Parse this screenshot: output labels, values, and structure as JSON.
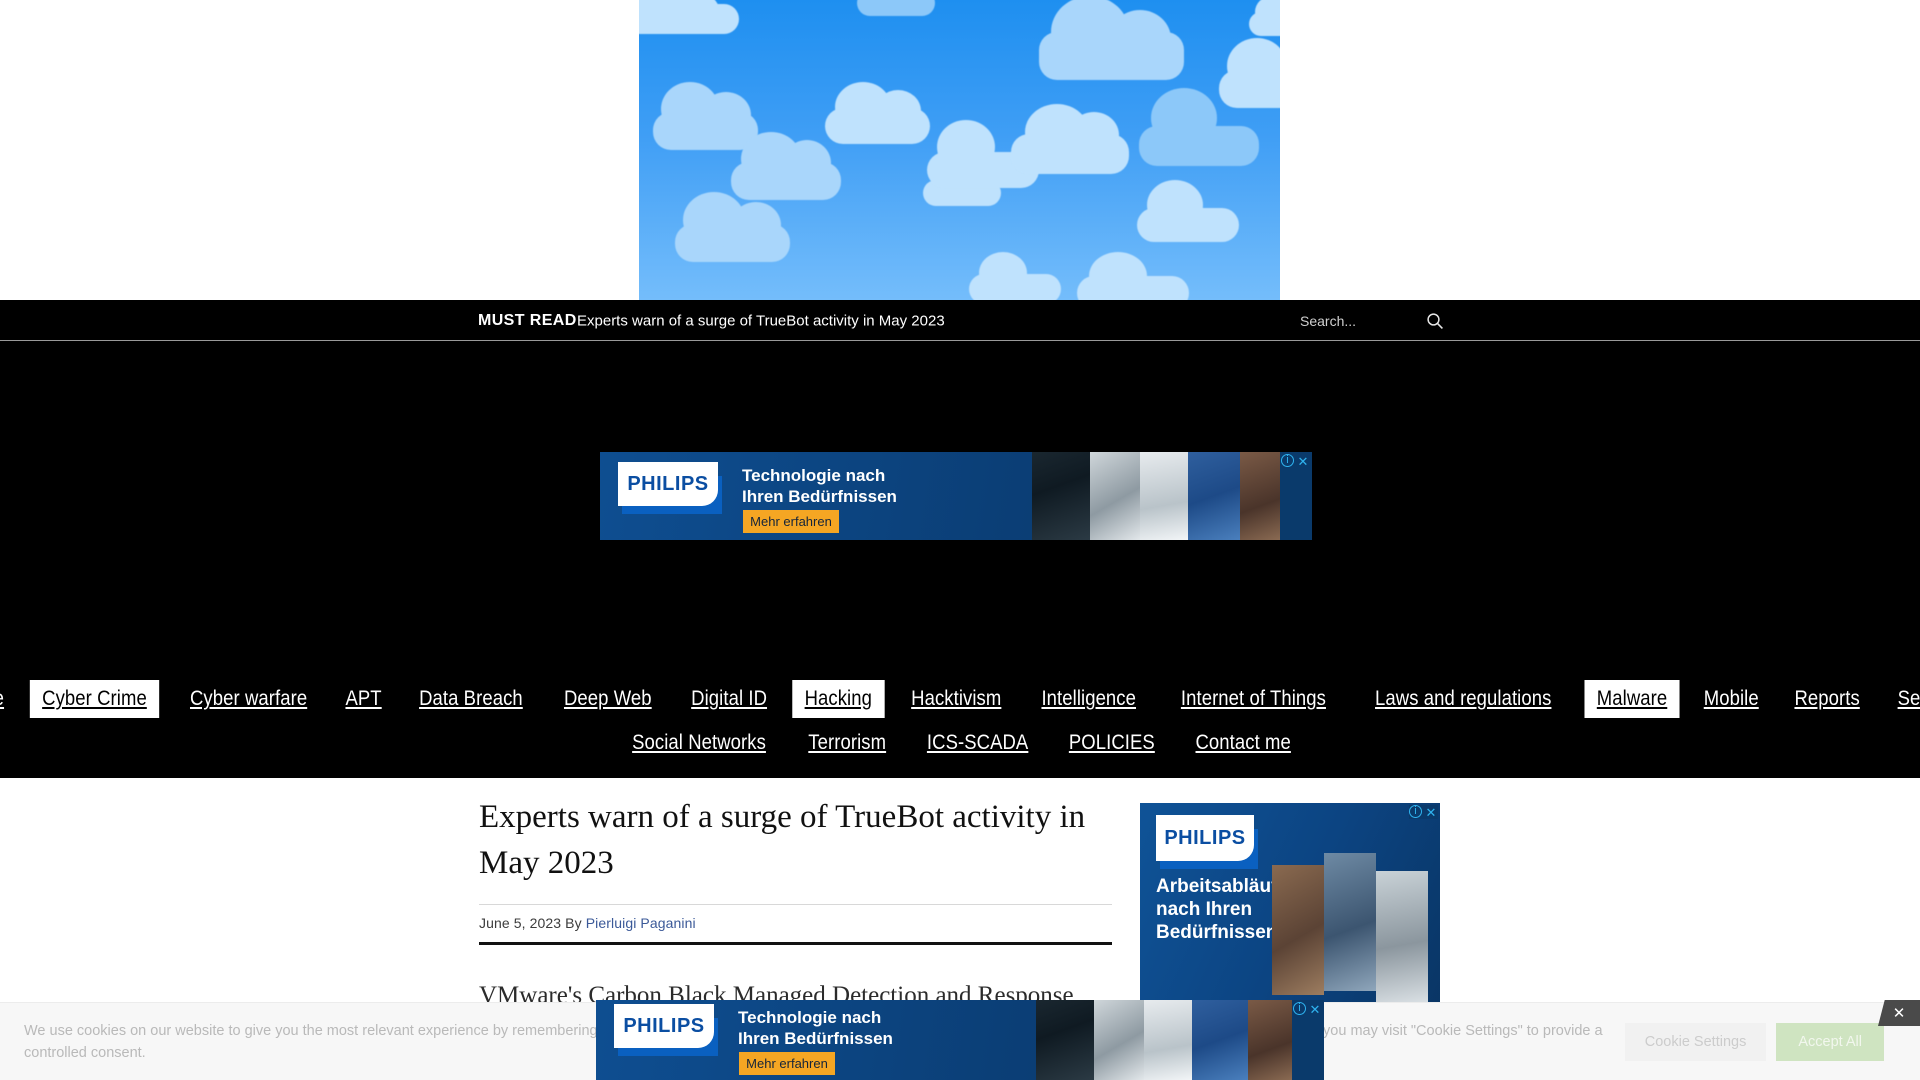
{
  "topbar": {
    "must_read_label": "MUST READ",
    "must_read_headline": "Experts warn of a surge of TrueBot activity in May 2023",
    "search_placeholder": "Search...",
    "search_value": "",
    "search_icon": "search-icon"
  },
  "nav": {
    "row1": [
      {
        "label": "Home",
        "active": false
      },
      {
        "label": "Cyber Crime",
        "active": true
      },
      {
        "label": "Cyber warfare",
        "active": false
      },
      {
        "label": "APT",
        "active": false
      },
      {
        "label": "Data Breach",
        "active": false
      },
      {
        "label": "Deep Web",
        "active": false
      },
      {
        "label": "Digital ID",
        "active": false
      },
      {
        "label": "Hacking",
        "active": true
      },
      {
        "label": "Hacktivism",
        "active": false
      },
      {
        "label": "Intelligence",
        "active": false
      },
      {
        "label": "Internet of Things",
        "active": false
      },
      {
        "label": "Laws and regulations",
        "active": false
      },
      {
        "label": "Malware",
        "active": true
      },
      {
        "label": "Mobile",
        "active": false
      },
      {
        "label": "Reports",
        "active": false
      },
      {
        "label": "Security",
        "active": false
      }
    ],
    "row2": [
      {
        "label": "Social Networks",
        "active": false
      },
      {
        "label": "Terrorism",
        "active": false
      },
      {
        "label": "ICS-SCADA",
        "active": false
      },
      {
        "label": "POLICIES",
        "active": false
      },
      {
        "label": "Contact me",
        "active": false
      }
    ]
  },
  "article": {
    "title": "Experts warn of a surge of TrueBot activity in May 2023",
    "date": "June 5, 2023",
    "by_label": "By",
    "author": "Pierluigi Paganini",
    "body": "VMware's Carbon Black Managed Detection and Response"
  },
  "ads": {
    "video_ad": {
      "name": "sky-clouds-video-ad"
    },
    "leaderboard": {
      "brand": "PHILIPS",
      "headline_line1": "Technologie nach",
      "headline_line2": "Ihren Bedürfnissen",
      "cta": "Mehr erfahren",
      "info_icon": "adchoices-info-icon",
      "close_icon": "close-icon"
    },
    "sidebar": {
      "brand": "PHILIPS",
      "headline_line1": "Arbeitsabläufe",
      "headline_line2": "nach Ihren",
      "headline_line3": "Bedürfnissen",
      "info_icon": "adchoices-info-icon",
      "close_icon": "close-icon"
    },
    "bottom": {
      "brand": "PHILIPS",
      "headline_line1": "Technologie nach",
      "headline_line2": "Ihren Bedürfnissen",
      "cta": "Mehr erfahren",
      "info_icon": "adchoices-info-icon",
      "close_icon": "close-icon",
      "dismiss_label": "✕"
    }
  },
  "cookie": {
    "text": "We use cookies on our website to give you the most relevant experience by remembering your preferences and repeat visits. By clicking \"Accept All\", you consent to the use of ALL the cookies. However, you may visit \"Cookie Settings\" to provide a controlled consent.",
    "settings_label": "Cookie Settings",
    "accept_label": "Accept All"
  },
  "colors": {
    "nav_bg": "#000000",
    "accent_link": "#3b5998",
    "ad_blue": "#0b4d8f",
    "cta_orange": "#f5a623",
    "accept_green": "#cfe4c1"
  }
}
